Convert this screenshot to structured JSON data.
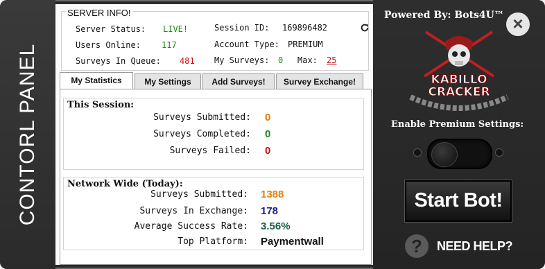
{
  "sidebar": {
    "title": "CONTORL PANEL"
  },
  "server": {
    "title": "SERVER INFO!",
    "status_label": "Server Status:",
    "status_value": "LIVE!",
    "users_label": "Users Online:",
    "users_value": "117",
    "queue_label": "Surveys In Queue:",
    "queue_value": "481",
    "session_label": "Session ID:",
    "session_value": "169896482",
    "account_label": "Account Type:",
    "account_value": "PREMIUM",
    "my_surveys_label": "My Surveys:",
    "my_surveys_value": "0",
    "max_label": "Max:",
    "max_value": "25"
  },
  "tabs": [
    {
      "label": "My Statistics"
    },
    {
      "label": "My Settings"
    },
    {
      "label": "Add Surveys!"
    },
    {
      "label": "Survey Exchange!"
    }
  ],
  "session": {
    "title": "This Session:",
    "rows": [
      {
        "label": "Surveys Submitted:",
        "value": "0",
        "color": "#e07b00"
      },
      {
        "label": "Surveys Completed:",
        "value": "0",
        "color": "#1a8a1a"
      },
      {
        "label": "Surveys Failed:",
        "value": "0",
        "color": "#cc1111"
      }
    ]
  },
  "network": {
    "title": "Network Wide (Today):",
    "rows": [
      {
        "label": "Surveys Submitted:",
        "value": "1388",
        "color": "#e0820a"
      },
      {
        "label": "Surveys In Exchange:",
        "value": "178",
        "color": "#1a237e"
      },
      {
        "label": "Average Success Rate:",
        "value": "3.56%",
        "color": "#1a5c4a"
      },
      {
        "label": "Top Platform:",
        "value": "Paymentwall",
        "color": "#111111"
      }
    ]
  },
  "right": {
    "powered": "Powered By: Bots4U™",
    "logo_line1": "KABILLO",
    "logo_line2": "CRACKER",
    "premium_label": "Enable Premium Settings:",
    "start_label": "Start Bot!",
    "help_label": "NEED HELP?",
    "help_icon": "?",
    "close_icon": "×"
  }
}
